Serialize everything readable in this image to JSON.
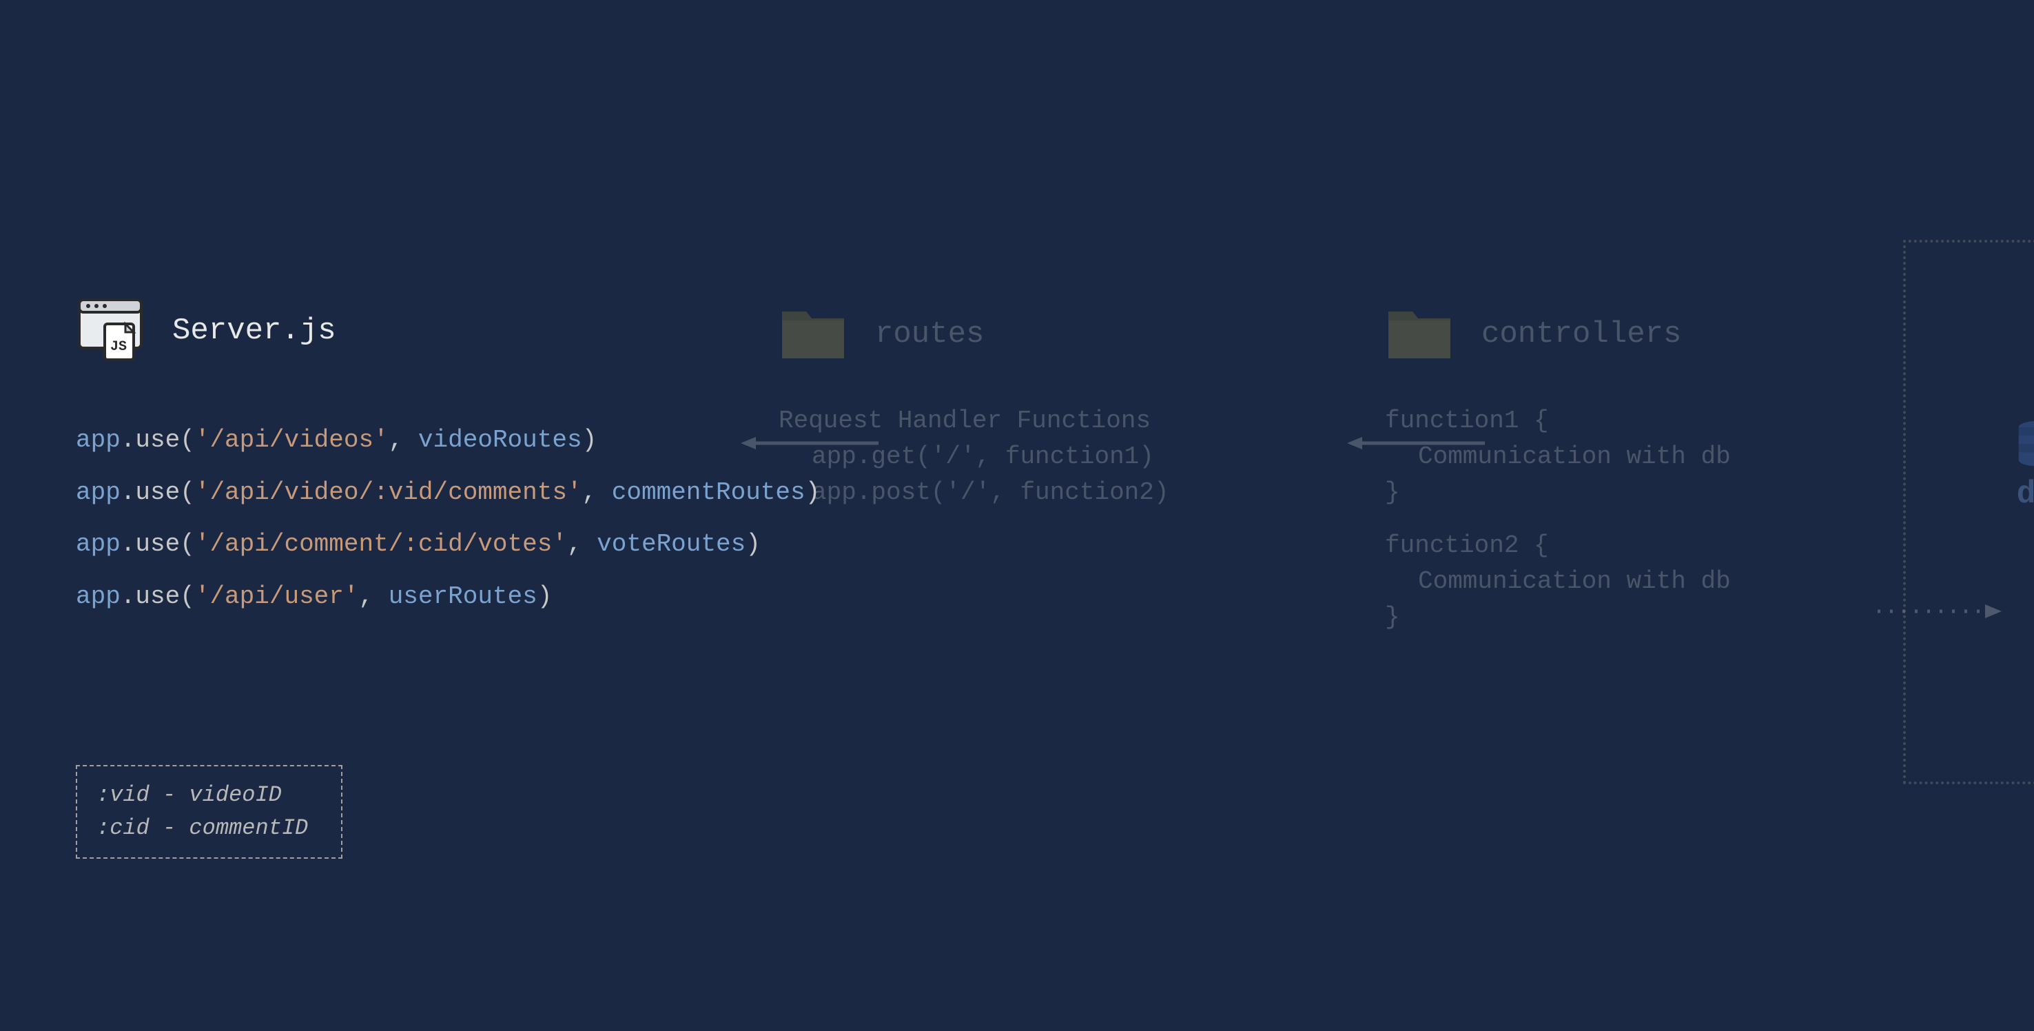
{
  "server": {
    "title": "Server.js",
    "lines": [
      {
        "path": "'/api/videos'",
        "ref": "videoRoutes"
      },
      {
        "path": "'/api/video/:vid/comments'",
        "ref": "commentRoutes"
      },
      {
        "path": "'/api/comment/:cid/votes'",
        "ref": "voteRoutes"
      },
      {
        "path": "'/api/user'",
        "ref": "userRoutes"
      }
    ],
    "var": "app",
    "method": "use"
  },
  "legend": {
    "line1": ":vid - videoID",
    "line2": ":cid - commentID"
  },
  "routes": {
    "title": "routes",
    "line1": "Request Handler Functions",
    "line2": "app.get('/', function1)",
    "line3": "app.post('/', function2)"
  },
  "controllers": {
    "title": "controllers",
    "fn1_open": "function1 {",
    "fn1_body": "Communication with db",
    "fn1_close": "}",
    "fn2_open": "function2 {",
    "fn2_body": "Communication with db",
    "fn2_close": "}"
  },
  "db": {
    "label": "db"
  }
}
